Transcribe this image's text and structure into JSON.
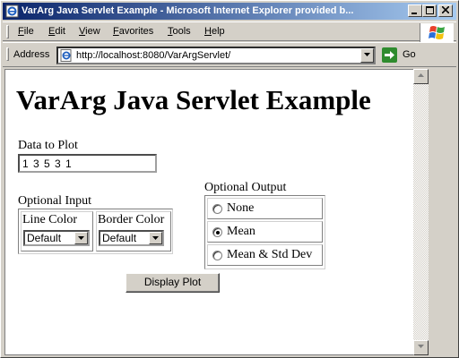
{
  "window": {
    "title": "VarArg Java Servlet Example - Microsoft Internet Explorer provided b..."
  },
  "menu": {
    "items": [
      {
        "label": "File"
      },
      {
        "label": "Edit"
      },
      {
        "label": "View"
      },
      {
        "label": "Favorites"
      },
      {
        "label": "Tools"
      },
      {
        "label": "Help"
      }
    ]
  },
  "address": {
    "label": "Address",
    "url": "http://localhost:8080/VarArgServlet/",
    "go_label": "Go"
  },
  "page": {
    "title": "VarArg Java Servlet Example",
    "data_label": "Data to Plot",
    "data_value": "1 3 5 3 1",
    "optional_input_label": "Optional Input",
    "line_color_label": "Line Color",
    "line_color_value": "Default",
    "border_color_label": "Border Color",
    "border_color_value": "Default",
    "optional_output_label": "Optional Output",
    "output_options": [
      {
        "label": "None",
        "selected": false
      },
      {
        "label": "Mean",
        "selected": true
      },
      {
        "label": "Mean & Std Dev",
        "selected": false
      }
    ],
    "display_button": "Display Plot"
  },
  "colors": {
    "titlebar_start": "#0a246a",
    "titlebar_end": "#a6caf0",
    "chrome": "#d4d0c8"
  }
}
